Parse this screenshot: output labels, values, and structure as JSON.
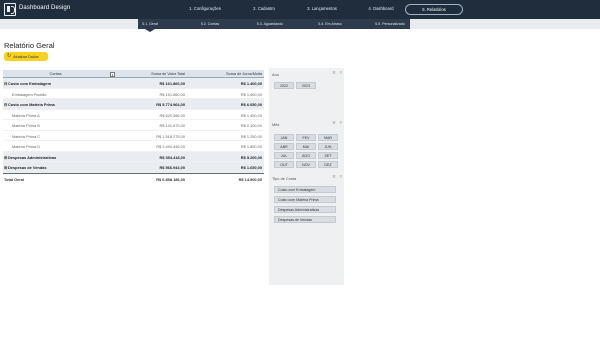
{
  "app": {
    "title": "Dashboard Design"
  },
  "nav": {
    "items": [
      {
        "label": "1. Configurações"
      },
      {
        "label": "2. Cadastro"
      },
      {
        "label": "3. Lançamentos"
      },
      {
        "label": "4. Dashboard"
      },
      {
        "label": "5. Relatórios"
      }
    ],
    "active": "5. Relatórios"
  },
  "subnav": {
    "items": [
      {
        "label": "5.1. Geral"
      },
      {
        "label": "5.2. Contas"
      },
      {
        "label": "5.3. Aguardando"
      },
      {
        "label": "5.4. Em Atraso"
      },
      {
        "label": "5.5. Personalizado"
      }
    ],
    "active": "5.1. Geral"
  },
  "page": {
    "title": "Relatório Geral",
    "refresh_label": "Atualizar Dados"
  },
  "pivot": {
    "headers": [
      "Contas",
      "Soma de Valor Total",
      "Soma de Juros/Multa"
    ],
    "rows": [
      {
        "type": "group",
        "label": "Custo com Embalagem",
        "value": "R$ 161.860,00",
        "juros": "R$ 1.400,00"
      },
      {
        "type": "child",
        "label": "Embalagem Padrão",
        "value": "R$ 161.860,00",
        "juros": "R$ 1.400,00"
      },
      {
        "type": "group",
        "label": "Custo com Matéria Prima",
        "value": "R$ 5.774.964,00",
        "juros": "R$ 6.650,00"
      },
      {
        "type": "child",
        "label": "Matéria Prima A",
        "value": "R$ 620.566,00",
        "juros": "R$ 1.450,00"
      },
      {
        "type": "child",
        "label": "Matéria Prima B",
        "value": "R$ 141.675,00",
        "juros": "R$ 2.100,00"
      },
      {
        "type": "child",
        "label": "Matéria Prima C",
        "value": "R$ 1.518.275,00",
        "juros": "R$ 1.250,00"
      },
      {
        "type": "child",
        "label": "Matéria Prima D",
        "value": "R$ 3.494.446,00",
        "juros": "R$ 1.850,00"
      },
      {
        "type": "group",
        "label": "Despesas Administrativas",
        "value": "R$ 354.418,00",
        "juros": "R$ 5.200,00"
      },
      {
        "type": "group",
        "label": "Despesas de Vendas",
        "value": "R$ 566.944,00",
        "juros": "R$ 1.650,00"
      },
      {
        "type": "total",
        "label": "Total Geral",
        "value": "R$ 6.858.186,00",
        "juros": "R$ 14.900,00"
      }
    ]
  },
  "slicers": {
    "ano": {
      "title": "Ano",
      "items": [
        "2022",
        "2023"
      ]
    },
    "mes": {
      "title": "Mês",
      "items": [
        "JAN",
        "FEV",
        "MAR",
        "ABR",
        "MAI",
        "JUN",
        "JUL",
        "AGO",
        "SET",
        "OUT",
        "NOV",
        "DEZ"
      ]
    },
    "tipo": {
      "title": "Tipo de Conta",
      "items": [
        "Custo com Embalagem",
        "Custo com Matéria Prima",
        "Despesas Administrativas",
        "Despesas de Vendas"
      ]
    },
    "icons": {
      "multiselect": "multiselect-icon",
      "clear": "clear-filter-icon"
    }
  },
  "colors": {
    "topbar": "#1f2d3d",
    "subnav_active": "#2d3b4c",
    "button": "#f4d21f"
  }
}
